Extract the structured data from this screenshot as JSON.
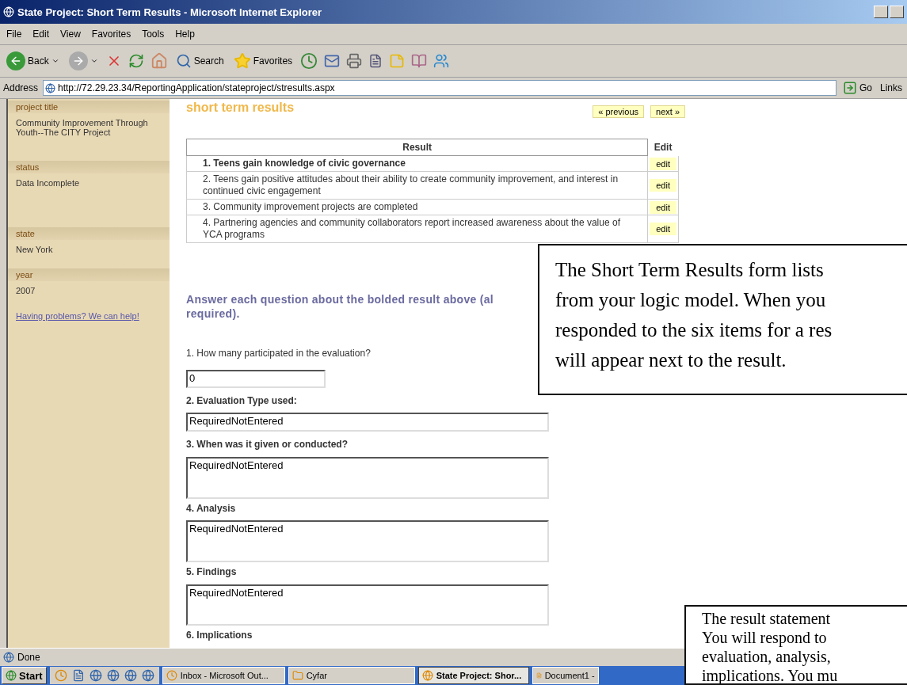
{
  "window": {
    "title": "State Project: Short Term Results - Microsoft Internet Explorer"
  },
  "menu": [
    "File",
    "Edit",
    "View",
    "Favorites",
    "Tools",
    "Help"
  ],
  "toolbar": {
    "back": "Back",
    "search": "Search",
    "favorites": "Favorites"
  },
  "address": {
    "label": "Address",
    "url": "http://72.29.23.34/ReportingApplication/stateproject/stresults.aspx",
    "go": "Go",
    "links": "Links"
  },
  "sidebar": [
    {
      "heading": "project title",
      "value": "Community Improvement Through Youth--The CITY Project"
    },
    {
      "heading": "status",
      "value": "Data Incomplete"
    },
    {
      "heading": "state",
      "value": "New York"
    },
    {
      "heading": "year",
      "value": "2007"
    }
  ],
  "help_link": "Having problems? We can help!",
  "page_title": "short term results",
  "pager": [
    "« previous",
    "next »"
  ],
  "table": {
    "columns": [
      "Result",
      "Edit"
    ],
    "rows": [
      {
        "text": "1. Teens gain knowledge of civic governance",
        "selected": true,
        "edit": "edit"
      },
      {
        "text": "2. Teens gain positive attitudes about their ability to create community improvement, and interest in continued civic engagement",
        "selected": false,
        "edit": "edit"
      },
      {
        "text": "3. Community improvement projects are completed",
        "selected": false,
        "edit": "edit"
      },
      {
        "text": "4. Partnering agencies and community collaborators report increased awareness about the value of YCA programs",
        "selected": false,
        "edit": "edit"
      }
    ]
  },
  "instructions": "Answer each question about the bolded result above (al",
  "instructions_2": "required).",
  "questions": [
    {
      "label": "1. How many participated in the evaluation?",
      "bold": false,
      "field": {
        "kind": "short",
        "value": "0"
      }
    },
    {
      "label": "2. Evaluation Type used:",
      "bold": true,
      "field": {
        "kind": "line",
        "value": "RequiredNotEntered"
      }
    },
    {
      "label": "3. When was it given or conducted?",
      "bold": true,
      "field": {
        "kind": "area",
        "value": "RequiredNotEntered"
      }
    },
    {
      "label": "4. Analysis",
      "bold": true,
      "field": {
        "kind": "area",
        "value": "RequiredNotEntered"
      }
    },
    {
      "label": "5. Findings",
      "bold": true,
      "field": {
        "kind": "area",
        "value": "RequiredNotEntered"
      }
    },
    {
      "label": "6. Implications",
      "bold": true
    }
  ],
  "callouts": [
    {
      "lines": [
        "The Short Term Results form lists",
        "from your logic model. When you",
        "responded to the six items for a res",
        "will appear next to the result."
      ]
    },
    {
      "lines": [
        "The result statement",
        "You will respond to",
        "evaluation, analysis,",
        "implications. You mu"
      ]
    }
  ],
  "status_bar": "Done",
  "taskbar": {
    "start": "Start",
    "tasks": [
      {
        "label": "Inbox - Microsoft Out...",
        "selected": false
      },
      {
        "label": "Cyfar",
        "selected": false
      },
      {
        "label": "State Project: Shor...",
        "selected": true
      },
      {
        "label": "Document1 -",
        "selected": false
      }
    ]
  }
}
